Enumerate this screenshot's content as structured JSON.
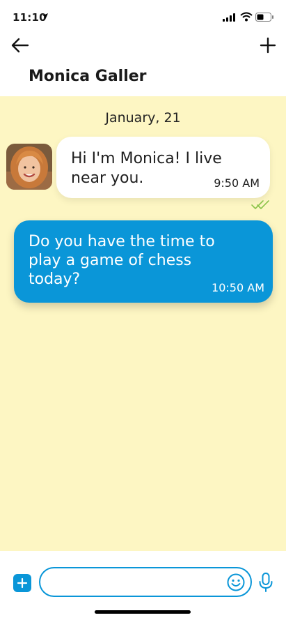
{
  "status_bar": {
    "time": "11:10"
  },
  "header": {
    "contact_name": "Monica Galler"
  },
  "chat": {
    "date": "January, 21",
    "messages": [
      {
        "direction": "incoming",
        "text": "Hi I'm Monica! I live near you.",
        "time": "9:50 AM"
      },
      {
        "direction": "outgoing",
        "text": "Do you have the time to play a game of chess today?",
        "time": "10:50 AM"
      }
    ]
  },
  "composer": {
    "value": ""
  },
  "colors": {
    "accent": "#0a96d8",
    "chat_background": "#fdf6c3",
    "read_receipt": "#8bc34a"
  },
  "icons": [
    "location-arrow-icon",
    "signal-icon",
    "wifi-icon",
    "battery-icon",
    "back-arrow-icon",
    "plus-icon",
    "double-check-icon",
    "attach-plus-icon",
    "emoji-icon",
    "microphone-icon"
  ]
}
